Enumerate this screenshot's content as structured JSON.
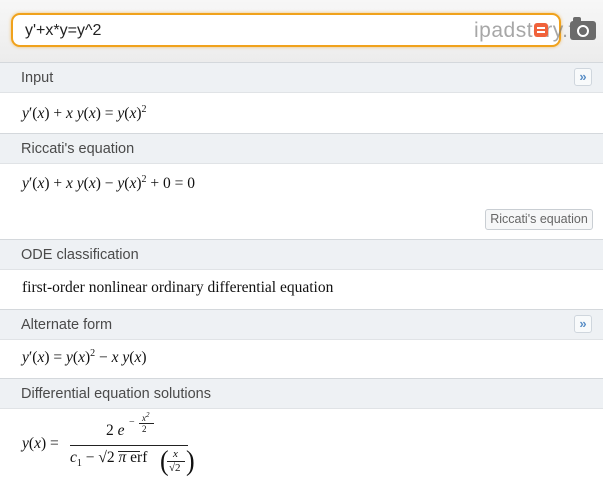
{
  "search": {
    "value": "y'+x*y=y^2"
  },
  "watermark": {
    "text": "ipadstory.fo"
  },
  "pods": [
    {
      "title": "Input",
      "content": "y′(x) + x y(x) = y(x)2"
    },
    {
      "title": "Riccati's equation",
      "content": "y′(x) + x y(x) − y(x)2 + 0 = 0",
      "button": "Riccati's equation"
    },
    {
      "title": "ODE classification",
      "content": "first-order nonlinear ordinary differential equation"
    },
    {
      "title": "Alternate form",
      "content": "y′(x) = y(x)2 − x y(x)"
    },
    {
      "title": "Differential equation solutions",
      "content": "y(x) = 2 e^(−x^2/2) / (c1 − √(2π) erf(x/√2))"
    }
  ],
  "more_icon": "»",
  "accent_color": "#f0a21c"
}
